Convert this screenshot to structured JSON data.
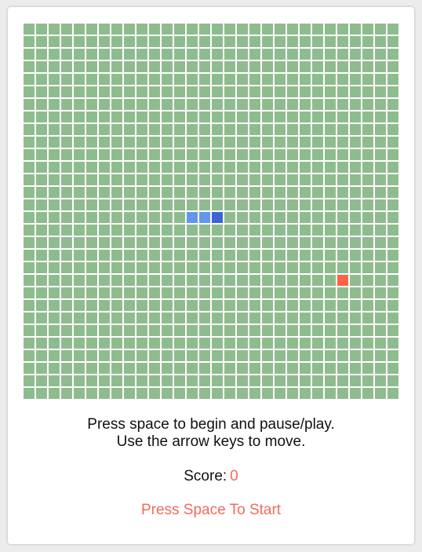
{
  "colors": {
    "grid_cell": "#8fbc8f",
    "snake_body": "#6495ed",
    "snake_head": "#3c64d2",
    "food": "#ff6347",
    "accent": "#f26a5b"
  },
  "board": {
    "columns": 30,
    "rows": 30,
    "snake": [
      {
        "col": 13,
        "row": 15,
        "part": "body"
      },
      {
        "col": 14,
        "row": 15,
        "part": "body"
      },
      {
        "col": 15,
        "row": 15,
        "part": "head"
      }
    ],
    "food": {
      "col": 25,
      "row": 20
    }
  },
  "instructions": {
    "line1": "Press space to begin and pause/play.",
    "line2": "Use the arrow keys to move."
  },
  "score": {
    "label": "Score:",
    "value": "0"
  },
  "start_prompt": "Press Space To Start"
}
